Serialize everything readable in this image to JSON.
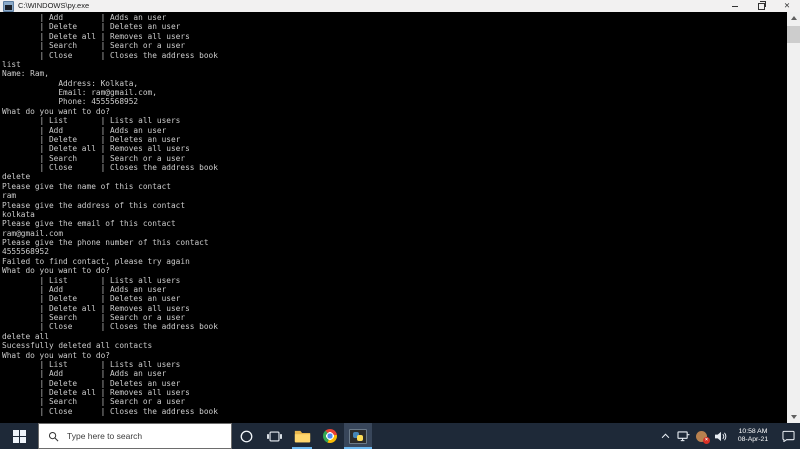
{
  "window": {
    "title": "C:\\WINDOWS\\py.exe",
    "close_glyph": "✕"
  },
  "console": {
    "lines": [
      "        | Add        | Adds an user",
      "        | Delete     | Deletes an user",
      "        | Delete all | Removes all users",
      "        | Search     | Search or a user",
      "        | Close      | Closes the address book",
      "list",
      "Name: Ram,",
      "            Address: Kolkata,",
      "            Email: ram@gmail.com,",
      "            Phone: 4555568952",
      "What do you want to do?",
      "        | List       | Lists all users",
      "        | Add        | Adds an user",
      "        | Delete     | Deletes an user",
      "        | Delete all | Removes all users",
      "        | Search     | Search or a user",
      "        | Close      | Closes the address book",
      "delete",
      "Please give the name of this contact",
      "ram",
      "Please give the address of this contact",
      "kolkata",
      "Please give the email of this contact",
      "ram@gmail.com",
      "Please give the phone number of this contact",
      "4555568952",
      "Failed to find contact, please try again",
      "What do you want to do?",
      "        | List       | Lists all users",
      "        | Add        | Adds an user",
      "        | Delete     | Deletes an user",
      "        | Delete all | Removes all users",
      "        | Search     | Search or a user",
      "        | Close      | Closes the address book",
      "delete all",
      "Sucessfully deleted all contacts",
      "What do you want to do?",
      "        | List       | Lists all users",
      "        | Add        | Adds an user",
      "        | Delete     | Deletes an user",
      "        | Delete all | Removes all users",
      "        | Search     | Search or a user",
      "        | Close      | Closes the address book"
    ]
  },
  "taskbar": {
    "search_placeholder": "Type here to search",
    "clock": {
      "time": "10:58 AM",
      "date": "08-Apr-21"
    }
  },
  "icons": {
    "titlebar_app": "console-window-icon",
    "start": "windows-logo-icon",
    "search": "magnifier-icon",
    "cortana": "cortana-circle-icon",
    "task_view": "task-view-icon",
    "file_explorer": "folder-icon",
    "chrome": "chrome-icon",
    "python_console": "python-console-icon",
    "tray_chevron": "chevron-up-icon",
    "network": "network-icon",
    "antivirus_alert": "shield-alert-icon",
    "volume": "speaker-icon",
    "action_center": "action-center-icon"
  },
  "colors": {
    "taskbar_bg": "#1e2938",
    "active_app_bg": "#38465a",
    "taskbar_underline": "#6cb8f0",
    "console_bg": "#000000",
    "console_fg": "#cccccc",
    "titlebar_bg": "#f2f1f1",
    "badge_red": "#d93025",
    "folder_yellow": "#f8d775"
  }
}
